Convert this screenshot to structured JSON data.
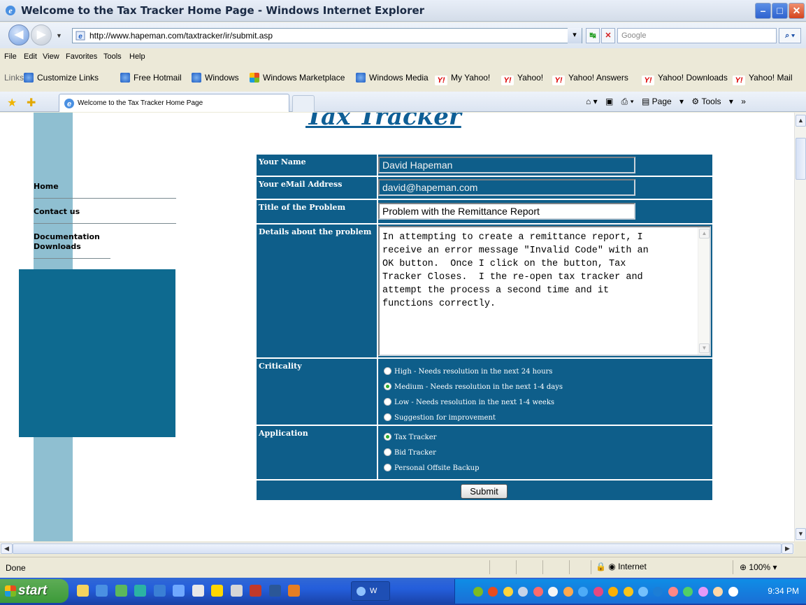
{
  "window": {
    "title": "Welcome to the Tax Tracker Home Page - Windows Internet Explorer"
  },
  "address": {
    "url": "http://www.hapeman.com/taxtracker/ir/submit.asp",
    "search_placeholder": "Google"
  },
  "menu": [
    "File",
    "Edit",
    "View",
    "Favorites",
    "Tools",
    "Help"
  ],
  "links": {
    "label": "Links",
    "items": [
      "Customize Links",
      "Free Hotmail",
      "Windows",
      "Windows Marketplace",
      "Windows Media",
      "My Yahoo!",
      "Yahoo!",
      "Yahoo! Answers",
      "Yahoo! Downloads",
      "Yahoo! Mail"
    ]
  },
  "tab": {
    "label": "Welcome to the Tax Tracker Home Page"
  },
  "commands": {
    "page": "Page",
    "tools": "Tools",
    "chevron": "»"
  },
  "page": {
    "title": "Tax Tracker",
    "nav": [
      "Home",
      "Contact us",
      "Documentation Downloads"
    ],
    "form": {
      "name_label": "Your Name",
      "name_value": "David Hapeman",
      "email_label": "Your eMail Address",
      "email_value": "david@hapeman.com",
      "problem_title_label": "Title of the Problem",
      "problem_title_value": "Problem with the Remittance Report",
      "details_label": "Details about the problem",
      "details_value": "In attempting to create a remittance report, I\nreceive an error message \"Invalid Code\" with an\nOK button.  Once I click on the button, Tax\nTracker Closes.  I the re-open tax tracker and\nattempt the process a second time and it\nfunctions correctly.",
      "criticality_label": "Criticality",
      "criticality_options": [
        {
          "label": "High - Needs resolution in the next 24 hours",
          "selected": false
        },
        {
          "label": "Medium - Needs resolution in the next 1-4 days",
          "selected": true
        },
        {
          "label": "Low - Needs resolution in the next 1-4 weeks",
          "selected": false
        },
        {
          "label": "Suggestion for improvement",
          "selected": false
        }
      ],
      "application_label": "Application",
      "application_options": [
        {
          "label": "Tax Tracker",
          "selected": true
        },
        {
          "label": "Bid Tracker",
          "selected": false
        },
        {
          "label": "Personal Offsite Backup",
          "selected": false
        }
      ],
      "submit_label": "Submit"
    }
  },
  "status": {
    "text": "Done",
    "zone": "Internet",
    "zoom": "100%"
  },
  "taskbar": {
    "start": "start",
    "ie_task": "W",
    "clock": "9:34 PM"
  },
  "colors": {
    "form_bg": "#0e5e8a",
    "side_strip": "#8fbfd1",
    "side_box": "#0e6a90",
    "title": "#0f5f96"
  }
}
